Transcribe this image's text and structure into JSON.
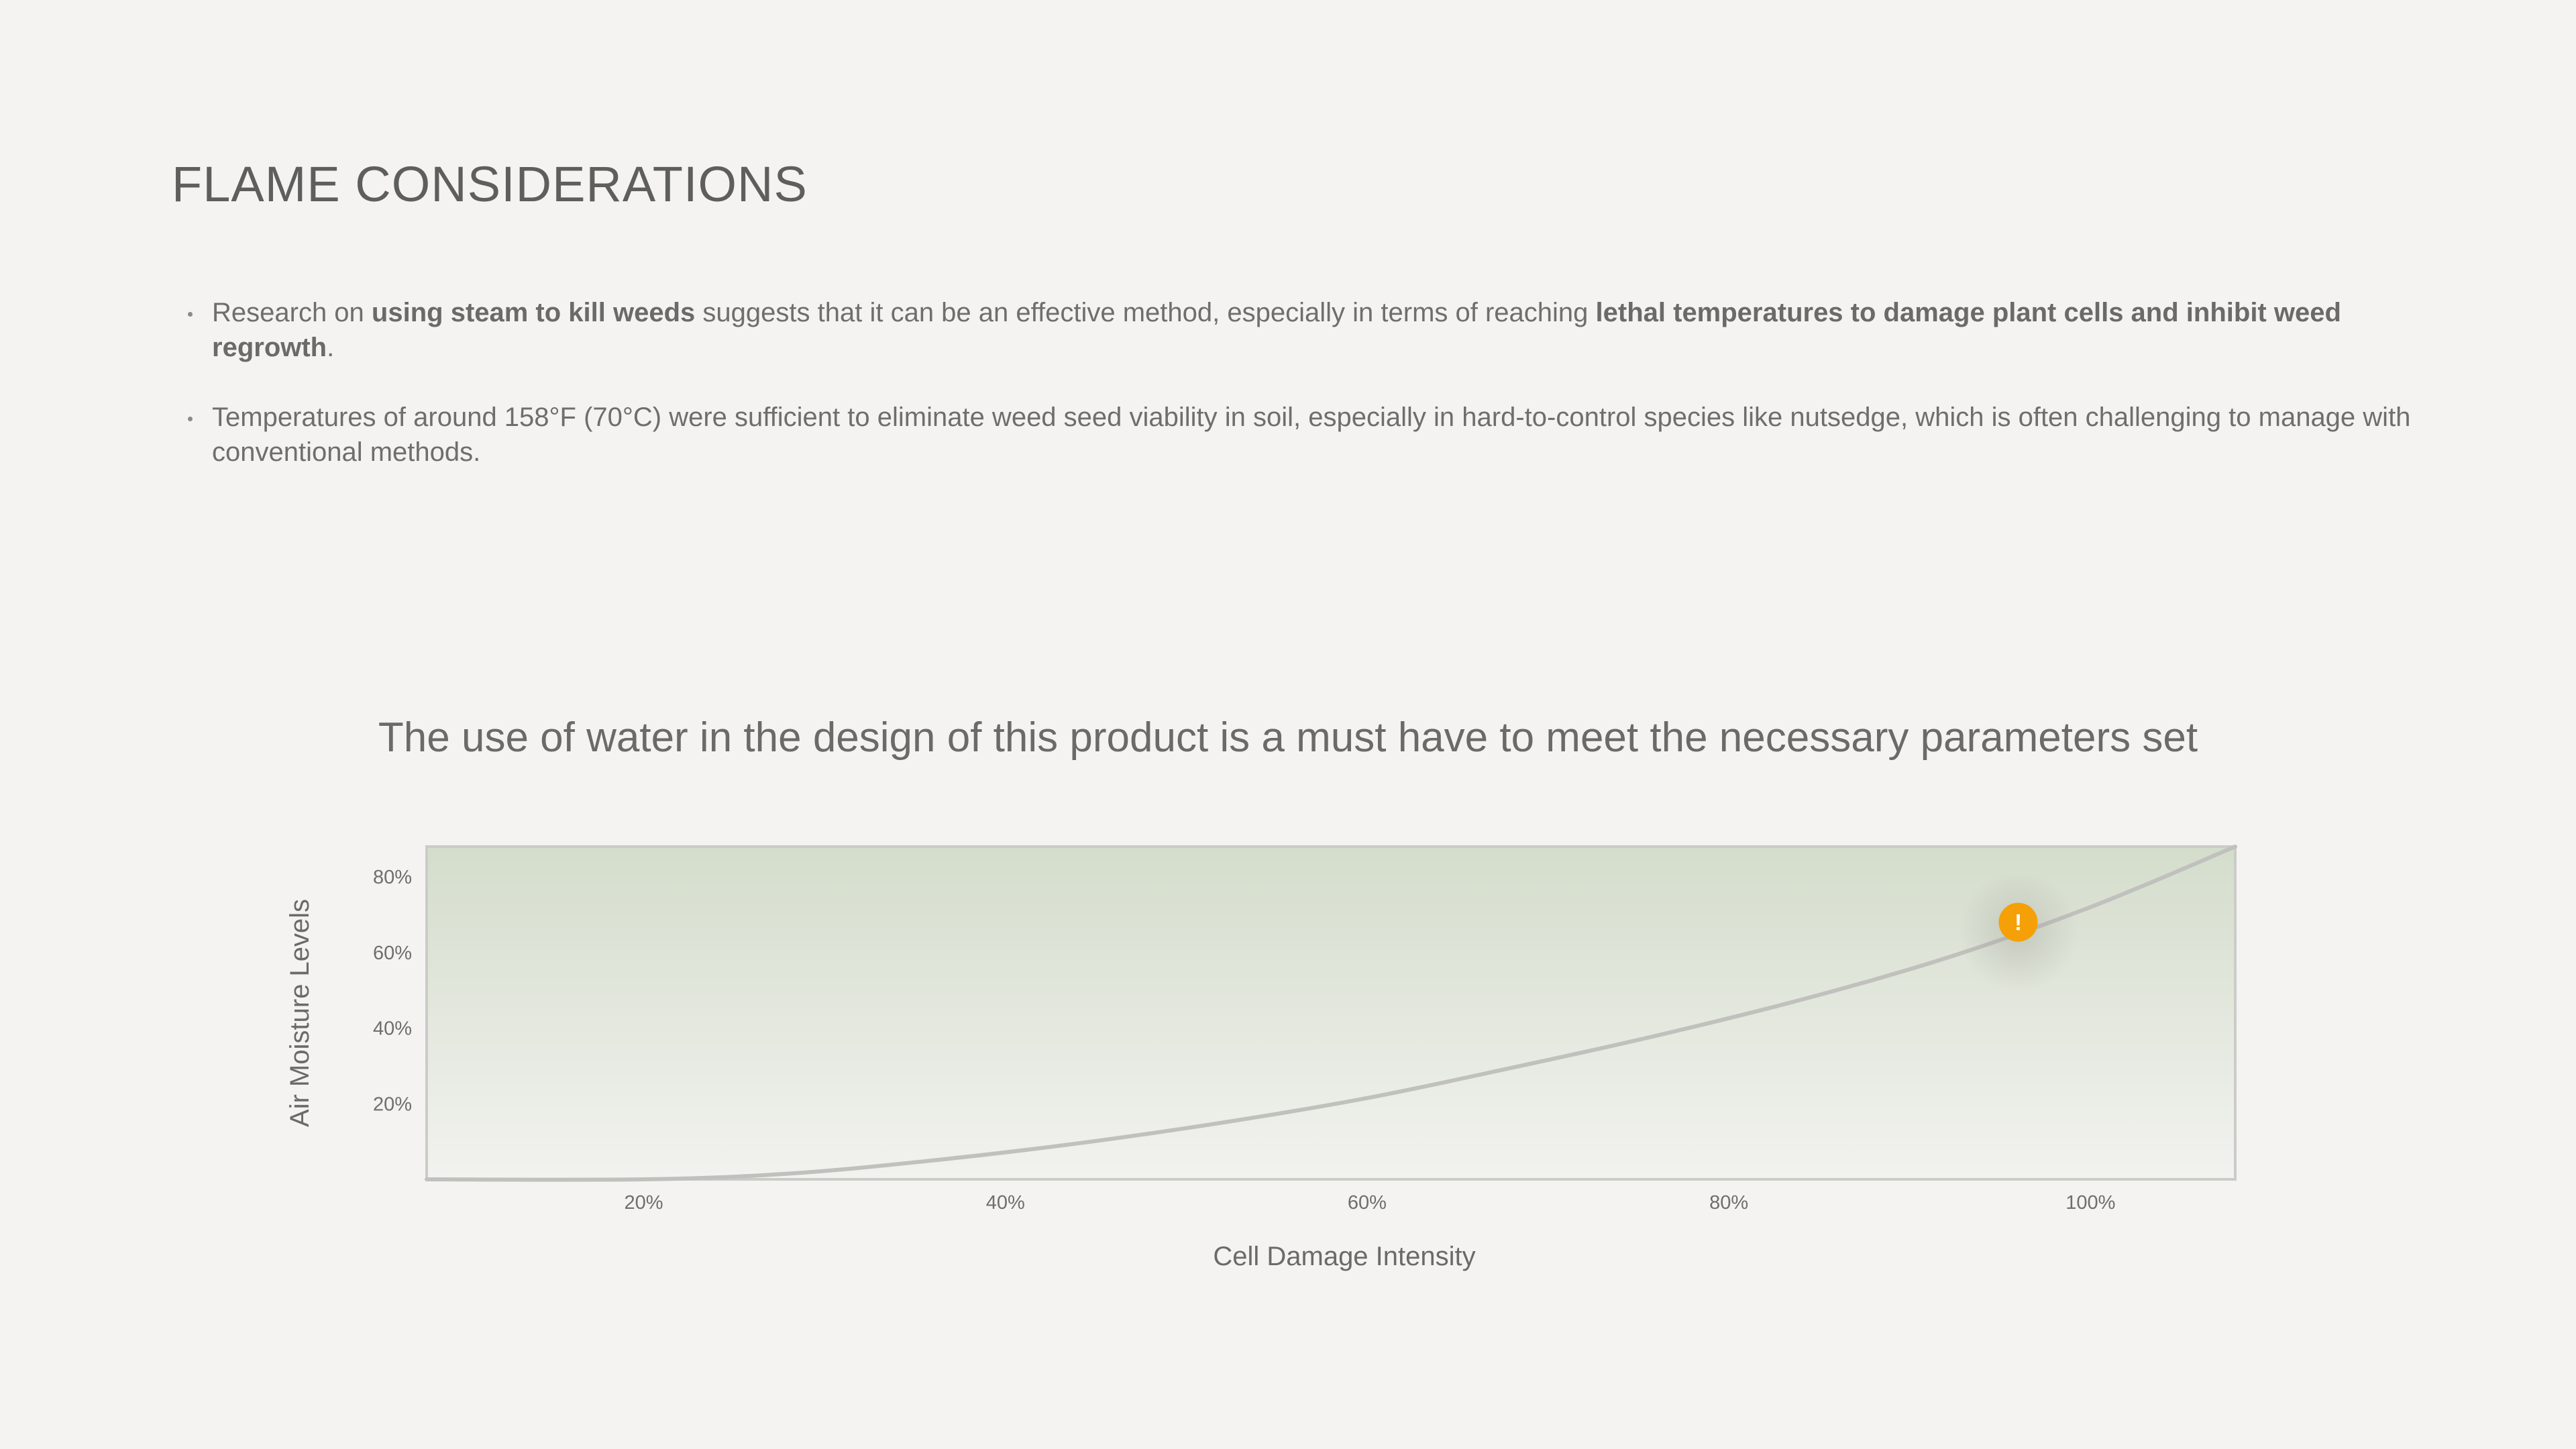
{
  "slide": {
    "title": "FLAME CONSIDERATIONS",
    "bullets": [
      [
        {
          "text": "Research on ",
          "bold": false
        },
        {
          "text": "using steam to kill weeds",
          "bold": true
        },
        {
          "text": " suggests that it can be an effective method, especially in terms of reaching ",
          "bold": false
        },
        {
          "text": "lethal temperatures to damage plant cells and inhibit weed regrowth",
          "bold": true
        },
        {
          "text": ".",
          "bold": false
        }
      ],
      [
        {
          "text": "Temperatures of around 158°F (70°C) were sufficient to eliminate weed seed viability in soil, especially in hard-to-control species like nutsedge, which is often challenging to manage with conventional methods.",
          "bold": false
        }
      ]
    ],
    "chart_headline": "The use of water in the design of this product is a must have to meet the necessary parameters set"
  },
  "chart_data": {
    "type": "line",
    "xlabel": "Cell Damage Intensity",
    "ylabel": "Air Moisture Levels",
    "xlim": [
      8,
      108
    ],
    "ylim": [
      0,
      88
    ],
    "x_ticks": [
      {
        "value": 20,
        "label": "20%"
      },
      {
        "value": 40,
        "label": "40%"
      },
      {
        "value": 60,
        "label": "60%"
      },
      {
        "value": 80,
        "label": "80%"
      },
      {
        "value": 100,
        "label": "100%"
      }
    ],
    "y_ticks": [
      {
        "value": 20,
        "label": "20%"
      },
      {
        "value": 40,
        "label": "40%"
      },
      {
        "value": 60,
        "label": "60%"
      },
      {
        "value": 80,
        "label": "80%"
      }
    ],
    "series": [
      {
        "x": [
          8,
          20,
          28,
          36,
          44,
          52,
          60,
          68,
          76,
          84,
          92,
          100,
          108
        ],
        "y": [
          0,
          0,
          1.5,
          5,
          9.5,
          15,
          21.5,
          29.5,
          38,
          47.5,
          58.5,
          72,
          88
        ]
      }
    ],
    "marker": {
      "x": 96,
      "y": 68,
      "label": "!"
    },
    "grid": false,
    "legend": "none",
    "colors": {
      "line": "#c0c0bd",
      "marker": "#f5a007",
      "fill_top": "#d4ddcc",
      "fill_bottom": "#f2f2ef",
      "frame": "#cbcbc8"
    }
  }
}
